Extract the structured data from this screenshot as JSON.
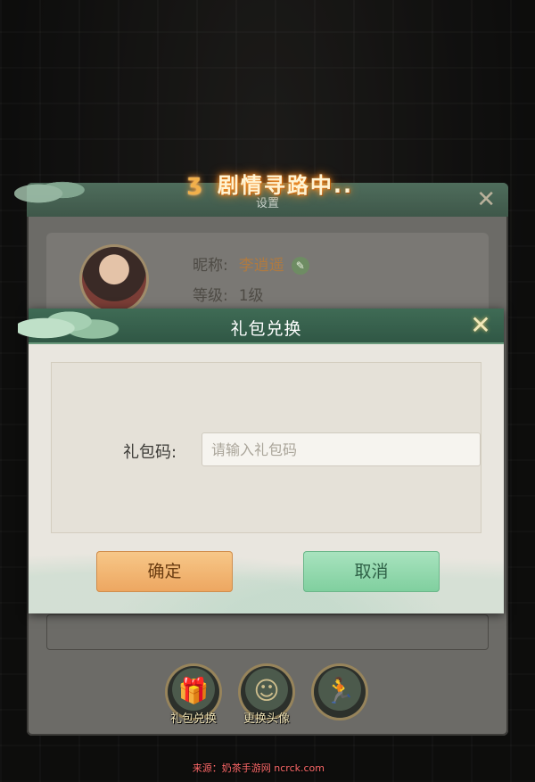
{
  "quest_banner": {
    "text": "剧情寻路中..",
    "glyph": "run-glyph"
  },
  "settings_panel": {
    "title": "设置",
    "profile": {
      "nickname_label": "昵称:",
      "nickname_value": "李逍遥",
      "level_label": "等级:",
      "level_value": "1级"
    },
    "bottom_buttons": [
      {
        "label": "礼包兑换",
        "icon": "gift-icon"
      },
      {
        "label": "更换头像",
        "icon": "portrait-icon"
      },
      {
        "label": "",
        "icon": "runner-icon"
      }
    ]
  },
  "gift_dialog": {
    "title": "礼包兑换",
    "code_label": "礼包码:",
    "code_placeholder": "请输入礼包码",
    "code_value": "",
    "confirm_label": "确定",
    "cancel_label": "取消"
  },
  "watermark": {
    "text": "来源：奶茶手游网 ncrck.com"
  },
  "colors": {
    "header_green": "#3f6b55",
    "confirm_orange": "#f7c889",
    "cancel_green": "#a9e3bf",
    "dialog_bg": "#e9e6df"
  }
}
